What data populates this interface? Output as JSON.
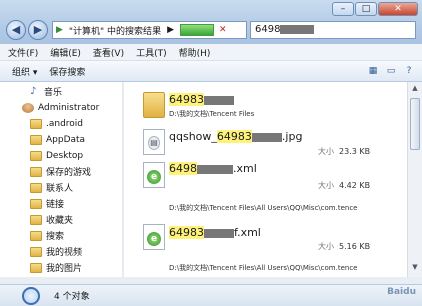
{
  "address": {
    "segments": [
      "\"计算机\" 中的搜索结果"
    ],
    "clear_icon": "✕",
    "search_text": "6498"
  },
  "menu": [
    "文件(F)",
    "编辑(E)",
    "查看(V)",
    "工具(T)",
    "帮助(H)"
  ],
  "toolbar": {
    "organize": "组织 ▾",
    "save_search": "保存搜索"
  },
  "window_buttons": [
    "–",
    "□",
    "✕"
  ],
  "sidebar": {
    "items": [
      {
        "label": "音乐",
        "icon": "music-icon"
      },
      {
        "label": "Administrator",
        "icon": "user-icon"
      },
      {
        "label": ".android",
        "icon": "folder-icon"
      },
      {
        "label": "AppData",
        "icon": "folder-icon"
      },
      {
        "label": "Desktop",
        "icon": "folder-icon"
      },
      {
        "label": "保存的游戏",
        "icon": "folder-icon"
      },
      {
        "label": "联系人",
        "icon": "folder-icon"
      },
      {
        "label": "链接",
        "icon": "folder-icon"
      },
      {
        "label": "收藏夹",
        "icon": "folder-icon"
      },
      {
        "label": "搜索",
        "icon": "folder-icon"
      },
      {
        "label": "我的视频",
        "icon": "folder-icon"
      },
      {
        "label": "我的图片",
        "icon": "folder-icon"
      }
    ]
  },
  "results": [
    {
      "name_hl": "64983",
      "name_rest": "",
      "path": "D:\\我的文档\\Tencent Files",
      "size_label": "",
      "size": "",
      "icon": "folder-icon"
    },
    {
      "name_pre": "qqshow_",
      "name_hl": "64983",
      "name_rest": ".jpg",
      "path": "",
      "size_label": "大小",
      "size": "23.3 KB",
      "icon": "image-file-icon"
    },
    {
      "name_hl": "6498",
      "name_rest": ".xml",
      "path": "D:\\我的文档\\Tencent Files\\All Users\\QQ\\Misc\\com.tence",
      "size_label": "大小",
      "size": "4.42 KB",
      "icon": "xml-file-icon"
    },
    {
      "name_hl": "64983",
      "name_rest": "f.xml",
      "path": "D:\\我的文档\\Tencent Files\\All Users\\QQ\\Misc\\com.tence",
      "size_label": "大小",
      "size": "5.16 KB",
      "icon": "xml-file-icon"
    }
  ],
  "status": {
    "count": "4 个对象"
  },
  "watermark": "Baidu"
}
